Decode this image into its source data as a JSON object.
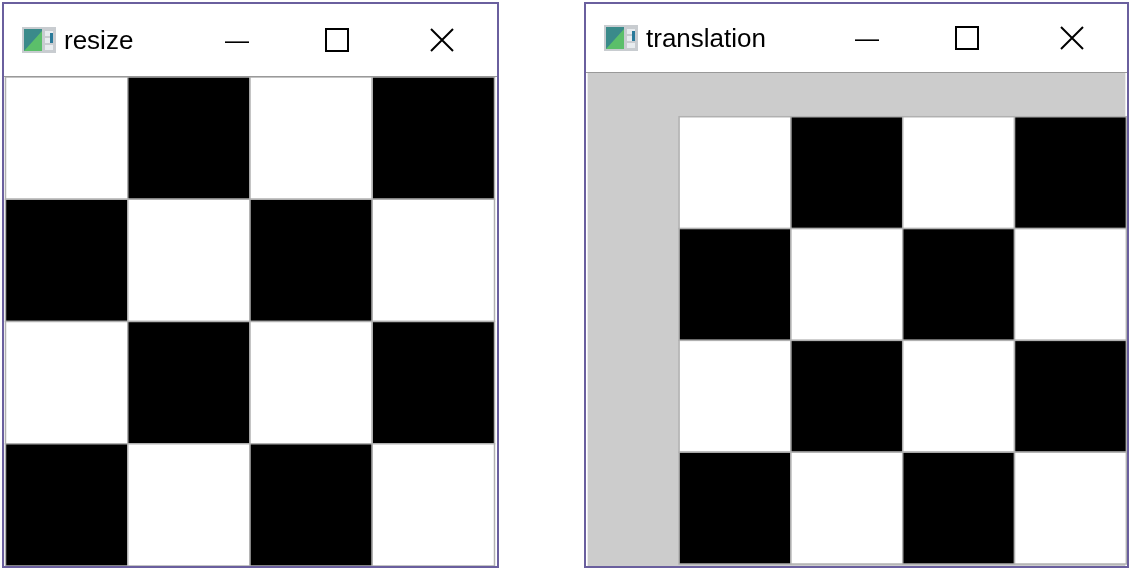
{
  "windows": [
    {
      "title": "resize",
      "minimize": "—",
      "kind": "fitted"
    },
    {
      "title": "translation",
      "minimize": "—",
      "kind": "shifted"
    }
  ]
}
